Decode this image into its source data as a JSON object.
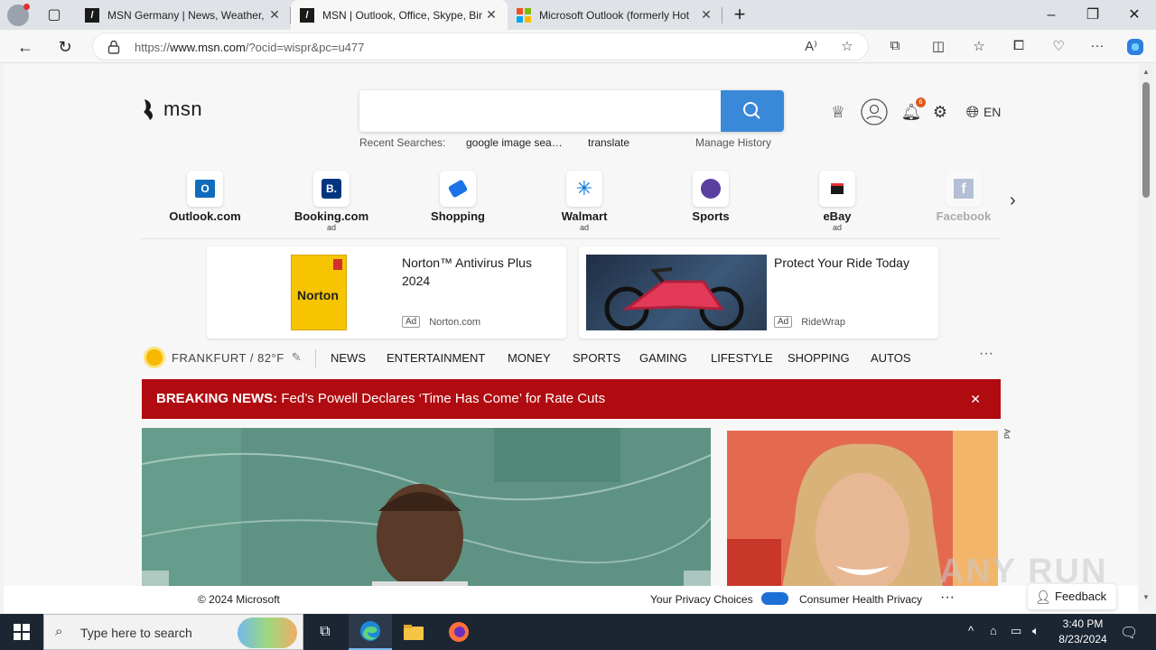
{
  "browser": {
    "tabs": [
      {
        "title": "MSN Germany | News, Weather,",
        "favicon": "msn-favicon"
      },
      {
        "title": "MSN | Outlook, Office, Skype, Bin",
        "favicon": "msn-favicon",
        "active": true
      },
      {
        "title": "Microsoft Outlook (formerly Hot",
        "favicon": "microsoft-favicon"
      }
    ],
    "url_prefix": "https://",
    "url_domain": "www.msn.com",
    "url_path": "/?ocid=wispr&pc=u477"
  },
  "msn": {
    "logo_text": "msn",
    "recent_label": "Recent Searches:",
    "recent_items": [
      "google image sea…",
      "translate"
    ],
    "manage_history": "Manage History",
    "notification_count": "6",
    "language": "EN",
    "quick_links": [
      {
        "label": "Outlook.com",
        "ad": "",
        "color": "#0f6cbd"
      },
      {
        "label": "Booking.com",
        "ad": "ad",
        "color": "#003580"
      },
      {
        "label": "Shopping",
        "ad": "",
        "color": "#1a73e8"
      },
      {
        "label": "Walmart",
        "ad": "ad",
        "color": "#0071dc"
      },
      {
        "label": "Sports",
        "ad": "",
        "color": "#5b3fa0"
      },
      {
        "label": "eBay",
        "ad": "ad",
        "color": "#e53238"
      },
      {
        "label": "Facebook",
        "ad": "",
        "color": "#3b5998"
      }
    ],
    "ads": [
      {
        "title": "Norton™ Antivirus Plus 2024",
        "tag": "Ad",
        "source": "Norton.com",
        "box_text": "Norton"
      },
      {
        "title": "Protect Your Ride Today",
        "tag": "Ad",
        "source": "RideWrap"
      }
    ],
    "weather": "FRANKFURT / 82°F",
    "nav": [
      "NEWS",
      "ENTERTAINMENT",
      "MONEY",
      "SPORTS",
      "GAMING",
      "LIFESTYLE",
      "SHOPPING",
      "AUTOS"
    ],
    "breaking_label": "BREAKING NEWS:",
    "breaking_text": "Fed’s Powell Declares ‘Time Has Come’ for Rate Cuts",
    "side_ad_label": "Ad",
    "footer": {
      "copyright": "© 2024 Microsoft",
      "privacy": "Your Privacy Choices",
      "consumer": "Consumer Health Privacy",
      "feedback": "Feedback"
    }
  },
  "watermark": "ANY RUN",
  "taskbar": {
    "search_placeholder": "Type here to search",
    "time": "3:40 PM",
    "date": "8/23/2024"
  },
  "colors": {
    "accent": "#3a88d8",
    "breaking": "#b00b10",
    "taskbar": "#1c2532"
  }
}
